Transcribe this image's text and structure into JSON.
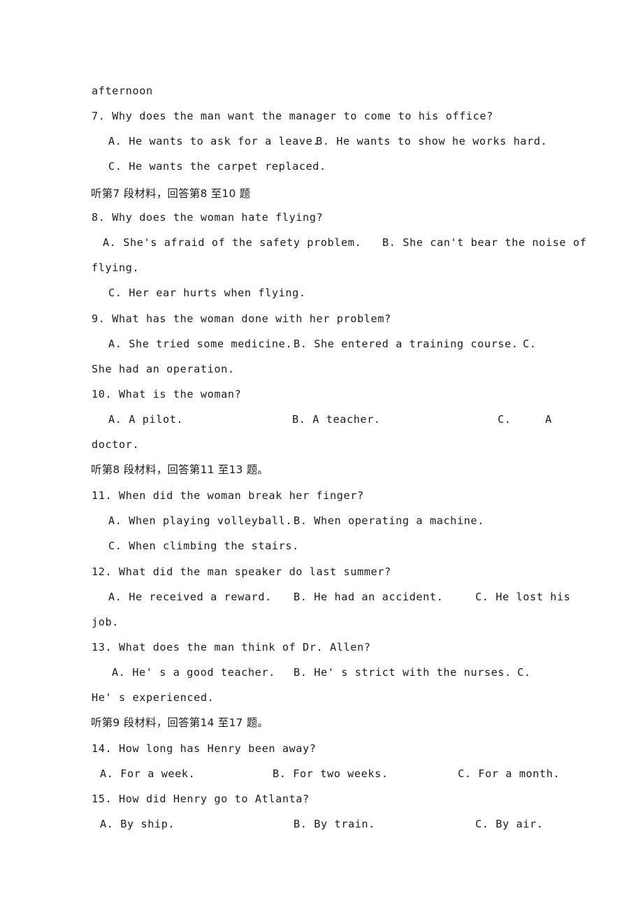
{
  "document": {
    "type": "listening-comprehension-exam",
    "language_mix": [
      "English",
      "Chinese"
    ],
    "page_background": "#ffffff",
    "text_color": "#1d1d1d"
  },
  "carryover_text": "afternoon",
  "directives": {
    "passage_7": "听第7 段材料，回答第8 至10 题",
    "passage_8": "听第8 段材料，回答第11 至13 题。",
    "passage_9": "听第9 段材料，回答第14 至17 题。"
  },
  "questions": [
    {
      "number": "7.",
      "stem": "7. Why does the man want the manager to come to his office?",
      "row1_a": "A. He wants to ask for a leave.",
      "row1_b": "B. He wants to show he works hard.",
      "row2_c": "C. He wants the carpet replaced."
    },
    {
      "number": "8.",
      "stem": "8. Why does the woman hate flying?",
      "row1_a": "A. She's afraid of the safety problem.",
      "row1_b": "B. She can't bear the noise of",
      "row2_wrap": "flying.",
      "row3_c": "C. Her ear hurts when flying."
    },
    {
      "number": "9.",
      "stem": "9. What has the woman done with her problem?",
      "row1_a": "A. She tried some medicine.",
      "row1_b": "B. She entered a training course.",
      "row1_c": "C.",
      "row2_wrap": "She had an operation."
    },
    {
      "number": "10.",
      "stem": "10. What is the woman?",
      "row1_a": "A. A pilot.",
      "row1_b": "B. A teacher.",
      "row1_c": "C.",
      "row1_d": "A",
      "row2_wrap": "doctor."
    },
    {
      "number": "11.",
      "stem": "11. When did the woman break her finger?",
      "row1_a": "A. When playing volleyball.",
      "row1_b": "B. When operating a machine.",
      "row2_c": "C. When climbing the stairs."
    },
    {
      "number": "12.",
      "stem": "12. What did the man speaker do last summer?",
      "row1_a": "A. He received a reward.",
      "row1_b": "B. He had an accident.",
      "row1_c": "C. He lost his",
      "row2_wrap": "job."
    },
    {
      "number": "13.",
      "stem": "13. What does the man think of Dr. Allen?",
      "row1_a": "A. He' s a good teacher.",
      "row1_b": "B. He' s strict with the nurses.",
      "row1_c": "C.",
      "row2_wrap": "He' s experienced."
    },
    {
      "number": "14.",
      "stem": "14. How long has Henry been away?",
      "row1_a": "A. For a week.",
      "row1_b": "B. For two weeks.",
      "row1_c": "C. For a month."
    },
    {
      "number": "15.",
      "stem": "15. How did Henry go to Atlanta?",
      "row1_a": "A. By ship.",
      "row1_b": "B. By train.",
      "row1_c": "C. By air."
    }
  ]
}
